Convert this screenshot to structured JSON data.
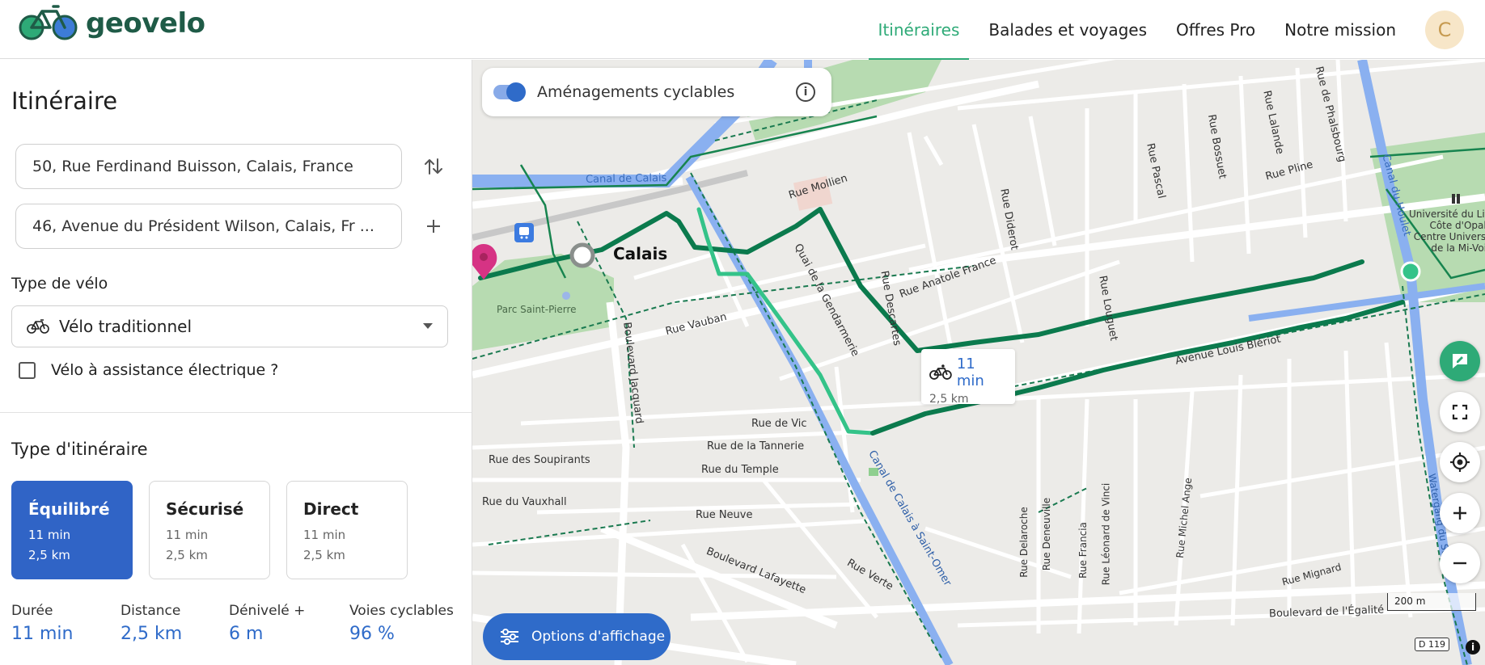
{
  "header": {
    "logo_text": "geovelo",
    "nav": [
      "Itinéraires",
      "Balades et voyages",
      "Offres Pro",
      "Notre mission"
    ],
    "active_nav": "Itinéraires",
    "avatar_initial": "C"
  },
  "sidebar": {
    "title": "Itinéraire",
    "origin": "50, Rue Ferdinand Buisson, Calais, France",
    "destination": "46, Avenue du Président Wilson, Calais, Fr ...",
    "bike_type_label": "Type de vélo",
    "bike_type_value": "Vélo traditionnel",
    "ebike_label": "Vélo à assistance électrique ?",
    "route_type_label": "Type d'itinéraire",
    "route_options": [
      {
        "title": "Équilibré",
        "time": "11 min",
        "distance": "2,5 km",
        "selected": true
      },
      {
        "title": "Sécurisé",
        "time": "11 min",
        "distance": "2,5 km",
        "selected": false
      },
      {
        "title": "Direct",
        "time": "11 min",
        "distance": "2,5 km",
        "selected": false
      }
    ],
    "stats": [
      {
        "label": "Durée",
        "value": "11 min"
      },
      {
        "label": "Distance",
        "value": "2,5 km"
      },
      {
        "label": "Dénivelé +",
        "value": "6 m"
      },
      {
        "label": "Voies cyclables",
        "value": "96 %"
      }
    ]
  },
  "map": {
    "toggle_label": "Aménagements cyclables",
    "toggle_on": true,
    "info_icon": "i",
    "route_label_time": "11 min",
    "route_label_distance": "2,5 km",
    "options_button": "Options d'affichage",
    "scale": "200 m",
    "road_shield": "D 119",
    "attribution_icon": "i",
    "labels": {
      "city": "Calais",
      "canal_calais": "Canal de Calais",
      "rue_mollien": "Rue Mollien",
      "rue_diderot": "Rue Diderot",
      "rue_pascal": "Rue Pascal",
      "rue_bossuet": "Rue Bossuet",
      "rue_lalande": "Rue Lalande",
      "rue_phalsbourg": "Rue de Phalsbourg",
      "canal_houlet": "Canal du Houlet",
      "rue_pline": "Rue Pline",
      "universite_1": "Université du Litt",
      "universite_2": "Côte d'Opale",
      "universite_3": "Centre Universit",
      "universite_4": "de la Mi-Voix",
      "quai_gendarmerie": "Quai de la Gendarmerie",
      "rue_descartes": "Rue Descartes",
      "rue_anatole": "Rue Anatole France",
      "rue_louguet": "Rue Louguet",
      "parc": "Parc Saint-Pierre",
      "rue_vauban": "Rue Vauban",
      "bd_jacquard": "Boulevard Jacquard",
      "av_bleriot": "Avenue Louis Blériot",
      "rue_vic": "Rue de Vic",
      "rue_tannerie": "Rue de la Tannerie",
      "rue_soupirants": "Rue des Soupirants",
      "rue_temple": "Rue du Temple",
      "rue_vauxhall": "Rue du Vauxhall",
      "rue_neuve": "Rue Neuve",
      "bd_lafayette": "Boulevard Lafayette",
      "rue_verte": "Rue Verte",
      "canal_saint_omer": "Canal de Calais à Saint-Omer",
      "rue_delaroche": "Rue Delaroche",
      "rue_deneuville": "Rue Deneuville",
      "rue_francia": "Rue Francia",
      "rue_leonard": "Rue Léonard de Vinci",
      "rue_michel_ange": "Rue Michel Ange",
      "rue_mignard": "Rue Mignard",
      "bd_egalite": "Boulevard de l'Égalité",
      "watergang": "Watergang du Sud"
    }
  },
  "colors": {
    "brand_green": "#2eaa77",
    "logo_green": "#1f5b47",
    "primary_blue": "#2f6bc9",
    "route_dark": "#0b7a4d",
    "route_light": "#34c389",
    "canal": "#8ab0f0",
    "park": "#b7dbb1",
    "pin": "#d63384"
  }
}
